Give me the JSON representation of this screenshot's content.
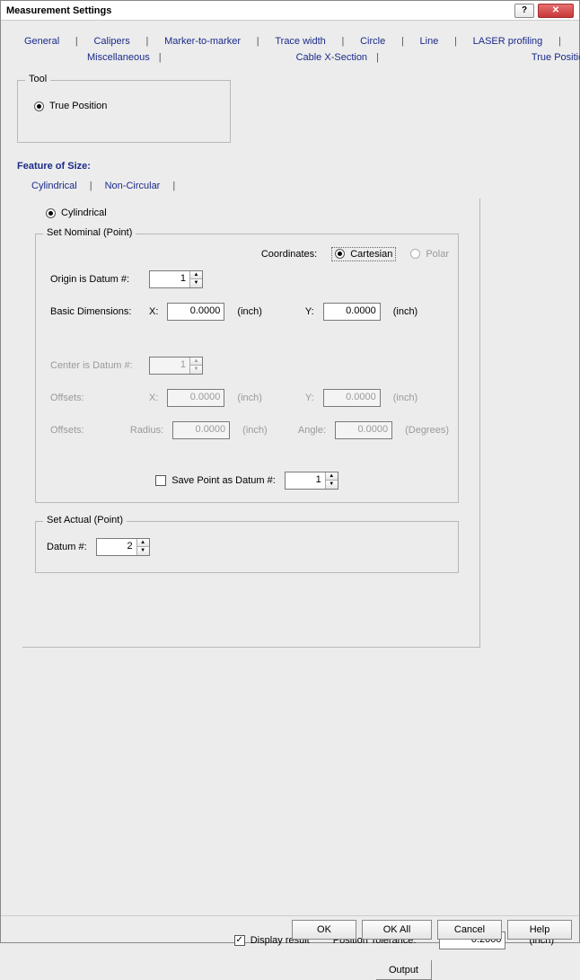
{
  "window": {
    "title": "Measurement Settings"
  },
  "tabs": {
    "row1": [
      "General",
      "Calipers",
      "Marker-to-marker",
      "Trace width",
      "Circle",
      "Line",
      "LASER profiling"
    ],
    "row2": [
      "Miscellaneous",
      "Cable X-Section",
      "True Position"
    ]
  },
  "tool_group": {
    "legend": "Tool",
    "option": "True Position"
  },
  "feature_header": "Feature of Size:",
  "subtabs": [
    "Cylindrical",
    "Non-Circular"
  ],
  "cylindrical": {
    "radio": "Cylindrical",
    "nominal": {
      "legend": "Set Nominal (Point)",
      "coords_label": "Coordinates:",
      "coord_cartesian": "Cartesian",
      "coord_polar": "Polar",
      "origin_label": "Origin is Datum #:",
      "origin_value": "1",
      "basic_label": "Basic Dimensions:",
      "x_label": "X:",
      "x_value": "0.0000",
      "y_label": "Y:",
      "y_value": "0.0000",
      "unit_inch": "(inch)",
      "center_label": "Center is Datum #:",
      "center_value": "1",
      "offsets_label": "Offsets:",
      "off_x_value": "0.0000",
      "off_y_value": "0.0000",
      "offsets2_label": "Offsets:",
      "radius_label": "Radius:",
      "radius_value": "0.0000",
      "angle_label": "Angle:",
      "angle_value": "0.0000",
      "unit_deg": "(Degrees)",
      "savepoint_label": "Save Point as Datum #:",
      "savepoint_value": "1"
    },
    "actual": {
      "legend": "Set Actual (Point)",
      "datum_label": "Datum #:",
      "datum_value": "2"
    }
  },
  "bottom": {
    "display_result": "Display result",
    "pos_tol_label": "Position Tolerance:",
    "pos_tol_value": "0.2000",
    "pos_tol_unit": "(inch)",
    "output": "Output"
  },
  "footer": {
    "ok": "OK",
    "ok_all": "OK All",
    "cancel": "Cancel",
    "help": "Help"
  }
}
